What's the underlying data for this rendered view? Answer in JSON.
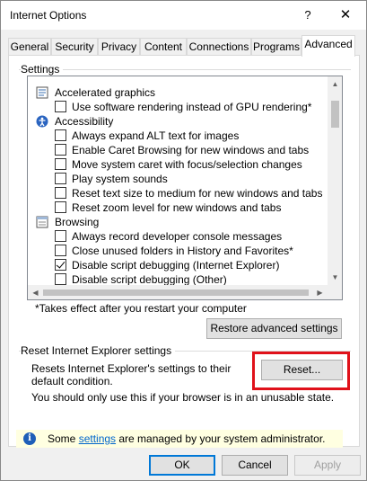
{
  "window": {
    "title": "Internet Options",
    "help_glyph": "?",
    "close_glyph": "✕"
  },
  "tabs": [
    {
      "label": "General"
    },
    {
      "label": "Security"
    },
    {
      "label": "Privacy"
    },
    {
      "label": "Content"
    },
    {
      "label": "Connections"
    },
    {
      "label": "Programs"
    },
    {
      "label": "Advanced",
      "active": true
    }
  ],
  "settings": {
    "group_label": "Settings",
    "rows": [
      {
        "type": "category",
        "icon": "monitor-icon",
        "label": "Accelerated graphics"
      },
      {
        "type": "checkbox",
        "checked": false,
        "label": "Use software rendering instead of GPU rendering*"
      },
      {
        "type": "category",
        "icon": "accessibility-icon",
        "label": "Accessibility"
      },
      {
        "type": "checkbox",
        "checked": false,
        "label": "Always expand ALT text for images"
      },
      {
        "type": "checkbox",
        "checked": false,
        "label": "Enable Caret Browsing for new windows and tabs"
      },
      {
        "type": "checkbox",
        "checked": false,
        "label": "Move system caret with focus/selection changes"
      },
      {
        "type": "checkbox",
        "checked": false,
        "label": "Play system sounds"
      },
      {
        "type": "checkbox",
        "checked": false,
        "label": "Reset text size to medium for new windows and tabs"
      },
      {
        "type": "checkbox",
        "checked": false,
        "label": "Reset zoom level for new windows and tabs"
      },
      {
        "type": "category",
        "icon": "browsing-icon",
        "label": "Browsing"
      },
      {
        "type": "checkbox",
        "checked": false,
        "label": "Always record developer console messages"
      },
      {
        "type": "checkbox",
        "checked": false,
        "label": "Close unused folders in History and Favorites*"
      },
      {
        "type": "checkbox",
        "checked": true,
        "label": "Disable script debugging (Internet Explorer)"
      },
      {
        "type": "checkbox",
        "checked": false,
        "label": "Disable script debugging (Other)"
      }
    ],
    "note": "*Takes effect after you restart your computer",
    "restore_button": "Restore advanced settings"
  },
  "reset": {
    "group_label": "Reset Internet Explorer settings",
    "description": "Resets Internet Explorer's settings to their default condition.",
    "reset_button": "Reset...",
    "warning": "You should only use this if your browser is in an unusable state."
  },
  "infobar": {
    "icon": "info-icon",
    "prefix": "Some ",
    "link": "settings",
    "suffix": " are managed by your system administrator."
  },
  "footer": {
    "ok": "OK",
    "cancel": "Cancel",
    "apply": "Apply"
  },
  "colors": {
    "highlight_box": "#e0111a",
    "infobar_bg": "#ffffe1",
    "link": "#0066cc"
  }
}
